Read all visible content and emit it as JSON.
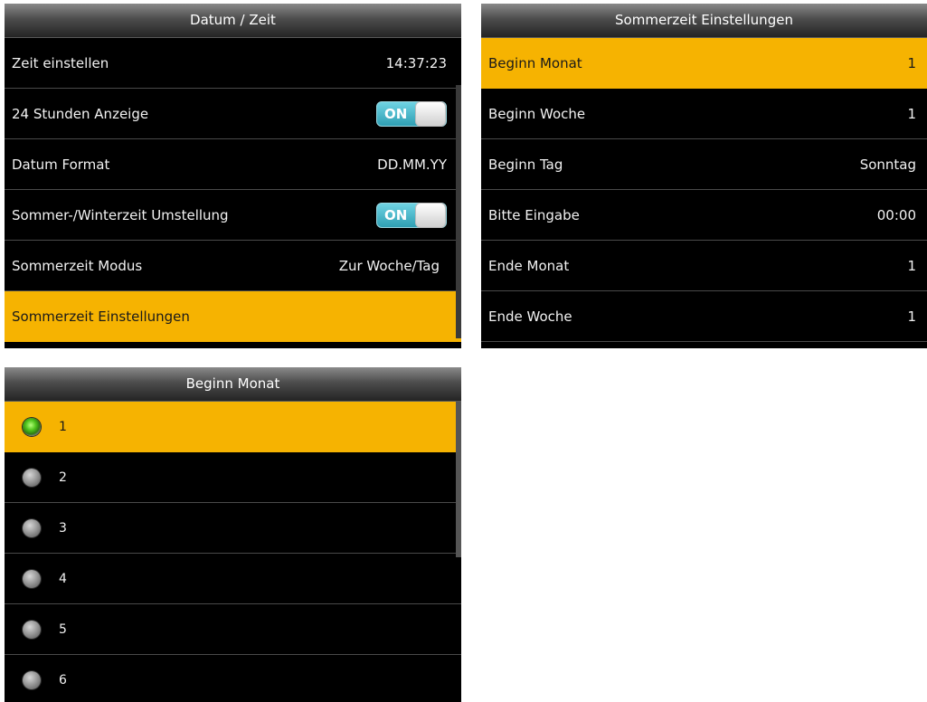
{
  "datetime_screen": {
    "title": "Datum / Zeit",
    "rows": [
      {
        "label": "Zeit einstellen",
        "value": "14:37:23"
      },
      {
        "label": "24 Stunden Anzeige",
        "toggle": "ON"
      },
      {
        "label": "Datum Format",
        "value": "DD.MM.YY"
      },
      {
        "label": "Sommer-/Winterzeit Umstellung",
        "toggle": "ON"
      },
      {
        "label": "Sommerzeit Modus",
        "value": "Zur Woche/Tag"
      },
      {
        "label": "Sommerzeit Einstellungen"
      }
    ]
  },
  "dst_screen": {
    "title": "Sommerzeit Einstellungen",
    "rows": [
      {
        "label": "Beginn Monat",
        "value": "1"
      },
      {
        "label": "Beginn Woche",
        "value": "1"
      },
      {
        "label": "Beginn Tag",
        "value": "Sonntag"
      },
      {
        "label": "Bitte Eingabe",
        "value": "00:00"
      },
      {
        "label": "Ende Monat",
        "value": "1"
      },
      {
        "label": "Ende Woche",
        "value": "1"
      }
    ]
  },
  "month_screen": {
    "title": "Beginn Monat",
    "options": [
      "1",
      "2",
      "3",
      "4",
      "5",
      "6"
    ],
    "selected": "1"
  },
  "colors": {
    "selected_row": "#f6b301",
    "background": "#000000",
    "toggle_on": "#2f9fb3",
    "radio_checked": "#4ec21b"
  }
}
